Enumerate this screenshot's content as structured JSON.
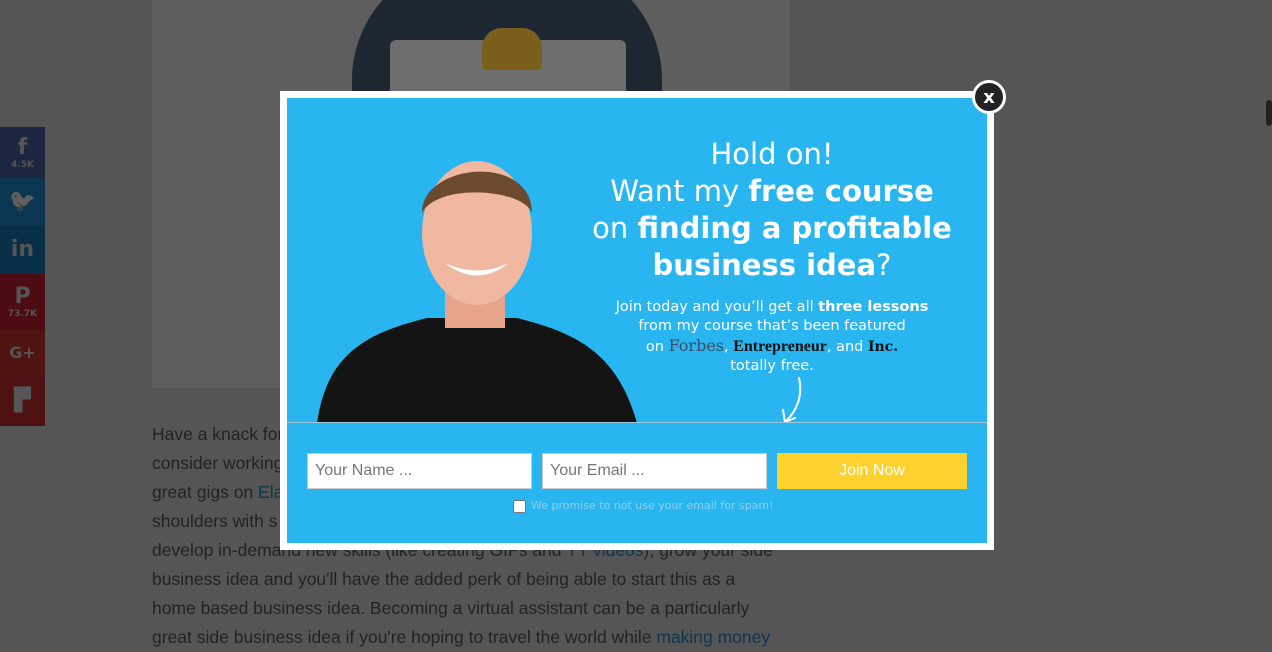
{
  "share": [
    {
      "network": "facebook",
      "icon": "f",
      "count": "4.5K",
      "color": "#1c2640"
    },
    {
      "network": "twitter",
      "icon": "🐦",
      "count": "",
      "color": "#0b3551"
    },
    {
      "network": "linkedin",
      "icon": "in",
      "count": "",
      "color": "#082f47"
    },
    {
      "network": "pinterest",
      "icon": "P",
      "count": "73.7K",
      "color": "#4c0c12"
    },
    {
      "network": "google-plus",
      "icon": "G+",
      "count": "",
      "color": "#4f1411"
    },
    {
      "network": "flipboard",
      "icon": "▛",
      "count": "",
      "color": "#4c1110"
    }
  ],
  "article": {
    "l1": "Have a knack for",
    "l2": "consider working",
    "l3": "great gigs on ",
    "l3_link": "Ela",
    "l4": "shoulders with s",
    "l5": "develop in-demand new skills (like creating GIFs and ",
    "l5_link": "YT videos",
    "l5_end": "), grow your side",
    "l6": "business idea and you'll have the added perk of being able to start this as a",
    "l7": "home based business idea. Becoming a virtual assistant can be a particularly",
    "l8": "great side business idea if you're hoping to travel the world while ",
    "l8_link": "making money"
  },
  "popup": {
    "h1": "Hold on!",
    "h2a": "Want my ",
    "h2b": "free course",
    "h3a": "on ",
    "h3b": "finding a profitable",
    "h4a": "business idea",
    "h4b": "?",
    "s1a": "Join today and you’ll get all ",
    "s1b": "three lessons",
    "s2": "from my course that’s been featured",
    "s3a": "on ",
    "forbes": "Forbes",
    "s3b": ", ",
    "entrepreneur": "Entrepreneur",
    "s3c": ", and ",
    "inc": "Inc.",
    "s4": "totally free.",
    "name_placeholder": "Your Name ...",
    "email_placeholder": "Your Email ...",
    "join_label": "Join Now",
    "promise": "We promise to not use your email for spam!",
    "close_label": "x",
    "accent": "#29b6f0",
    "button_color": "#fed22e"
  }
}
